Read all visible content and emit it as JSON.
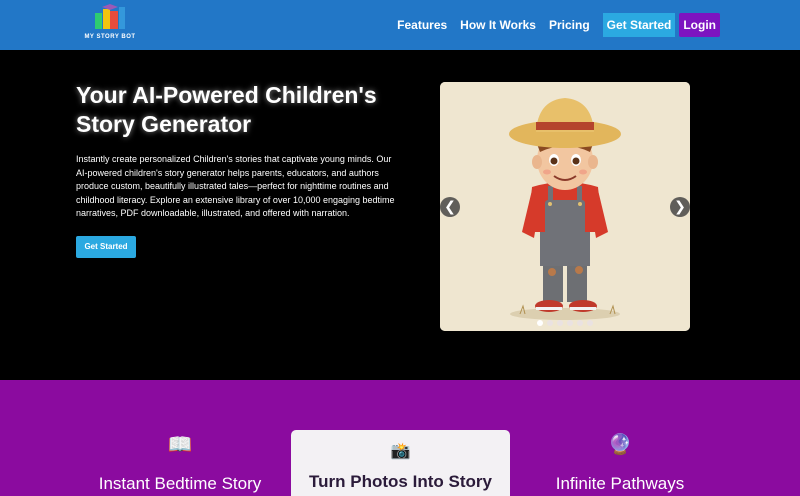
{
  "brand": {
    "logo_text": "MY STORY BOT"
  },
  "nav": {
    "links": [
      "Features",
      "How It Works",
      "Pricing"
    ],
    "get_started": "Get Started",
    "login": "Login"
  },
  "hero": {
    "title": "Your AI-Powered Children's Story Generator",
    "description": "Instantly create personalized Children's stories that captivate young minds. Our AI-powered children's story generator helps parents, educators, and authors produce custom, beautifully illustrated tales—perfect for nighttime routines and childhood literacy. Explore an extensive library of over 10,000 engaging bedtime narratives, PDF downloadable, illustrated, and offered with narration.",
    "cta": "Get Started"
  },
  "carousel": {
    "prev_glyph": "❮",
    "next_glyph": "❯",
    "slide_count": 6,
    "active_index": 0
  },
  "features": [
    {
      "icon": "📖",
      "icon_name": "open-book-icon",
      "title": "Instant Bedtime Story"
    },
    {
      "icon": "📸",
      "icon_name": "camera-flash-icon",
      "title": "Turn Photos Into Story"
    },
    {
      "icon": "🔮",
      "icon_name": "crystal-ball-icon",
      "title": "Infinite Pathways"
    }
  ],
  "colors": {
    "nav_bg": "#2277c7",
    "accent_blue": "#2ba9e1",
    "accent_purple": "#7d14c0",
    "features_bg": "#8b0b9f"
  }
}
